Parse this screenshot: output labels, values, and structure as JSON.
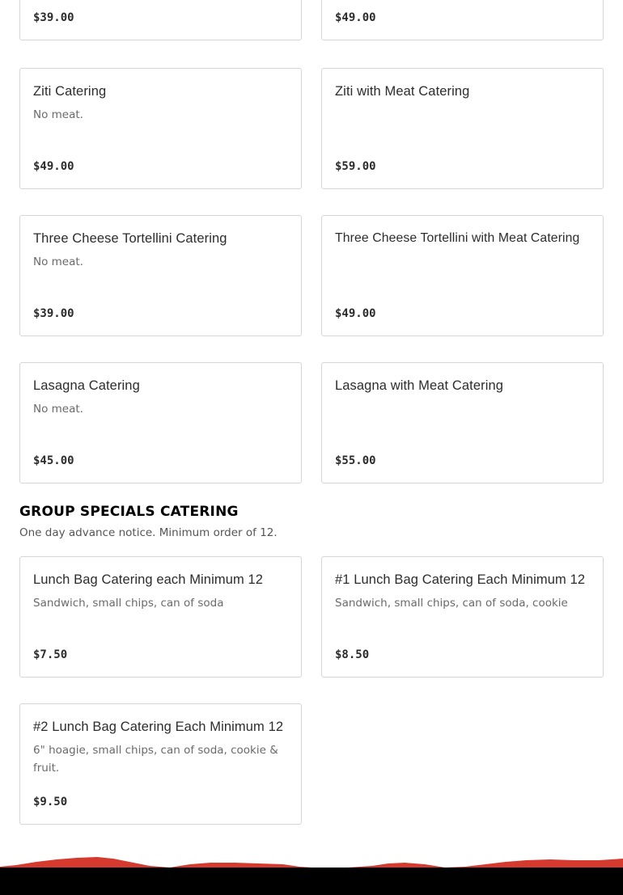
{
  "menu_items_top": [
    {
      "price": "$39.00"
    },
    {
      "price": "$49.00"
    },
    {
      "name": "Ziti Catering",
      "description": "No meat.",
      "price": "$49.00"
    },
    {
      "name": "Ziti with Meat Catering",
      "description": "",
      "price": "$59.00"
    },
    {
      "name": "Three Cheese Tortellini Catering",
      "description": "No meat.",
      "price": "$39.00"
    },
    {
      "name": "Three Cheese Tortellini with Meat Catering",
      "description": "",
      "price": "$49.00"
    },
    {
      "name": "Lasagna Catering",
      "description": "No meat.",
      "price": "$45.00"
    },
    {
      "name": "Lasagna with Meat Catering",
      "description": "",
      "price": "$55.00"
    }
  ],
  "group_specials": {
    "title": "GROUP SPECIALS CATERING",
    "subtitle": "One day advance notice. Minimum order of 12.",
    "items": [
      {
        "name": "Lunch Bag Catering each Minimum 12",
        "description": "Sandwich, small chips, can of soda",
        "price": "$7.50"
      },
      {
        "name": "#1 Lunch Bag Catering Each Minimum 12",
        "description": "Sandwich, small chips, can of soda, cookie",
        "price": "$8.50"
      },
      {
        "name": "#2 Lunch Bag Catering Each Minimum 12",
        "description": "6\" hoagie, small chips, can of soda, cookie & fruit.",
        "price": "$9.50"
      }
    ]
  },
  "colors": {
    "footer_accent": "#d63a2f",
    "footer_background": "#000000",
    "card_border": "#d6d6d6"
  }
}
